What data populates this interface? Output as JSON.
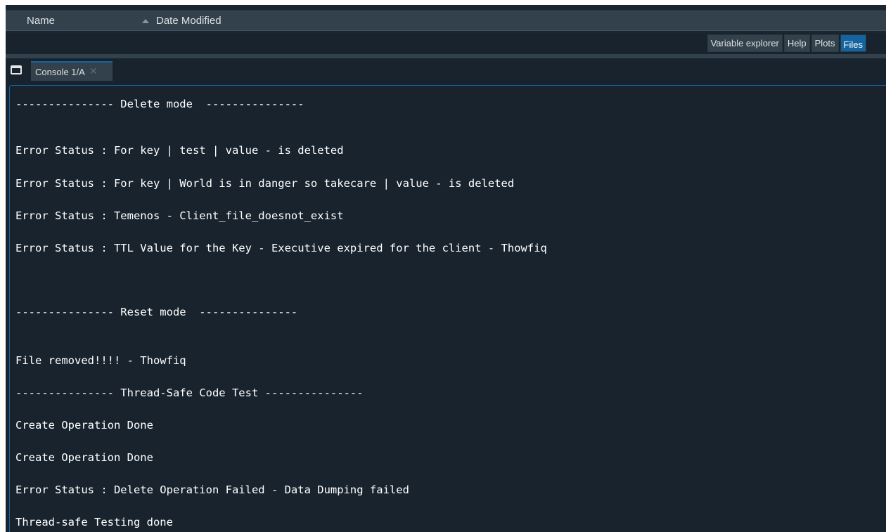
{
  "file_browser": {
    "columns": [
      {
        "label": "Name"
      },
      {
        "label": "Date Modified"
      }
    ]
  },
  "pane_tabs": [
    {
      "label": "Variable explorer",
      "active": false
    },
    {
      "label": "Help",
      "active": false
    },
    {
      "label": "Plots",
      "active": false
    },
    {
      "label": "Files",
      "active": true
    }
  ],
  "console": {
    "tab_label": "Console 1/A",
    "lines": [
      "--------------- Delete mode  ---------------",
      "Error Status : For key | test | value - is deleted",
      "Error Status : For key | World is in danger so takecare | value - is deleted",
      "Error Status : Temenos - Client_file_doesnot_exist",
      "Error Status : TTL Value for the Key - Executive expired for the client - Thowfiq",
      "--------------- Reset mode  ---------------",
      "File removed!!!! - Thowfiq",
      "--------------- Thread-Safe Code Test ---------------",
      "Create Operation Done",
      "Create Operation Done",
      "Error Status : Delete Operation Failed - Data Dumping failed",
      "Thread-safe Testing done"
    ]
  },
  "colors": {
    "background": "#19232d",
    "accent": "#1464a0",
    "tab_bg": "#32414b",
    "text": "#ffffff"
  }
}
